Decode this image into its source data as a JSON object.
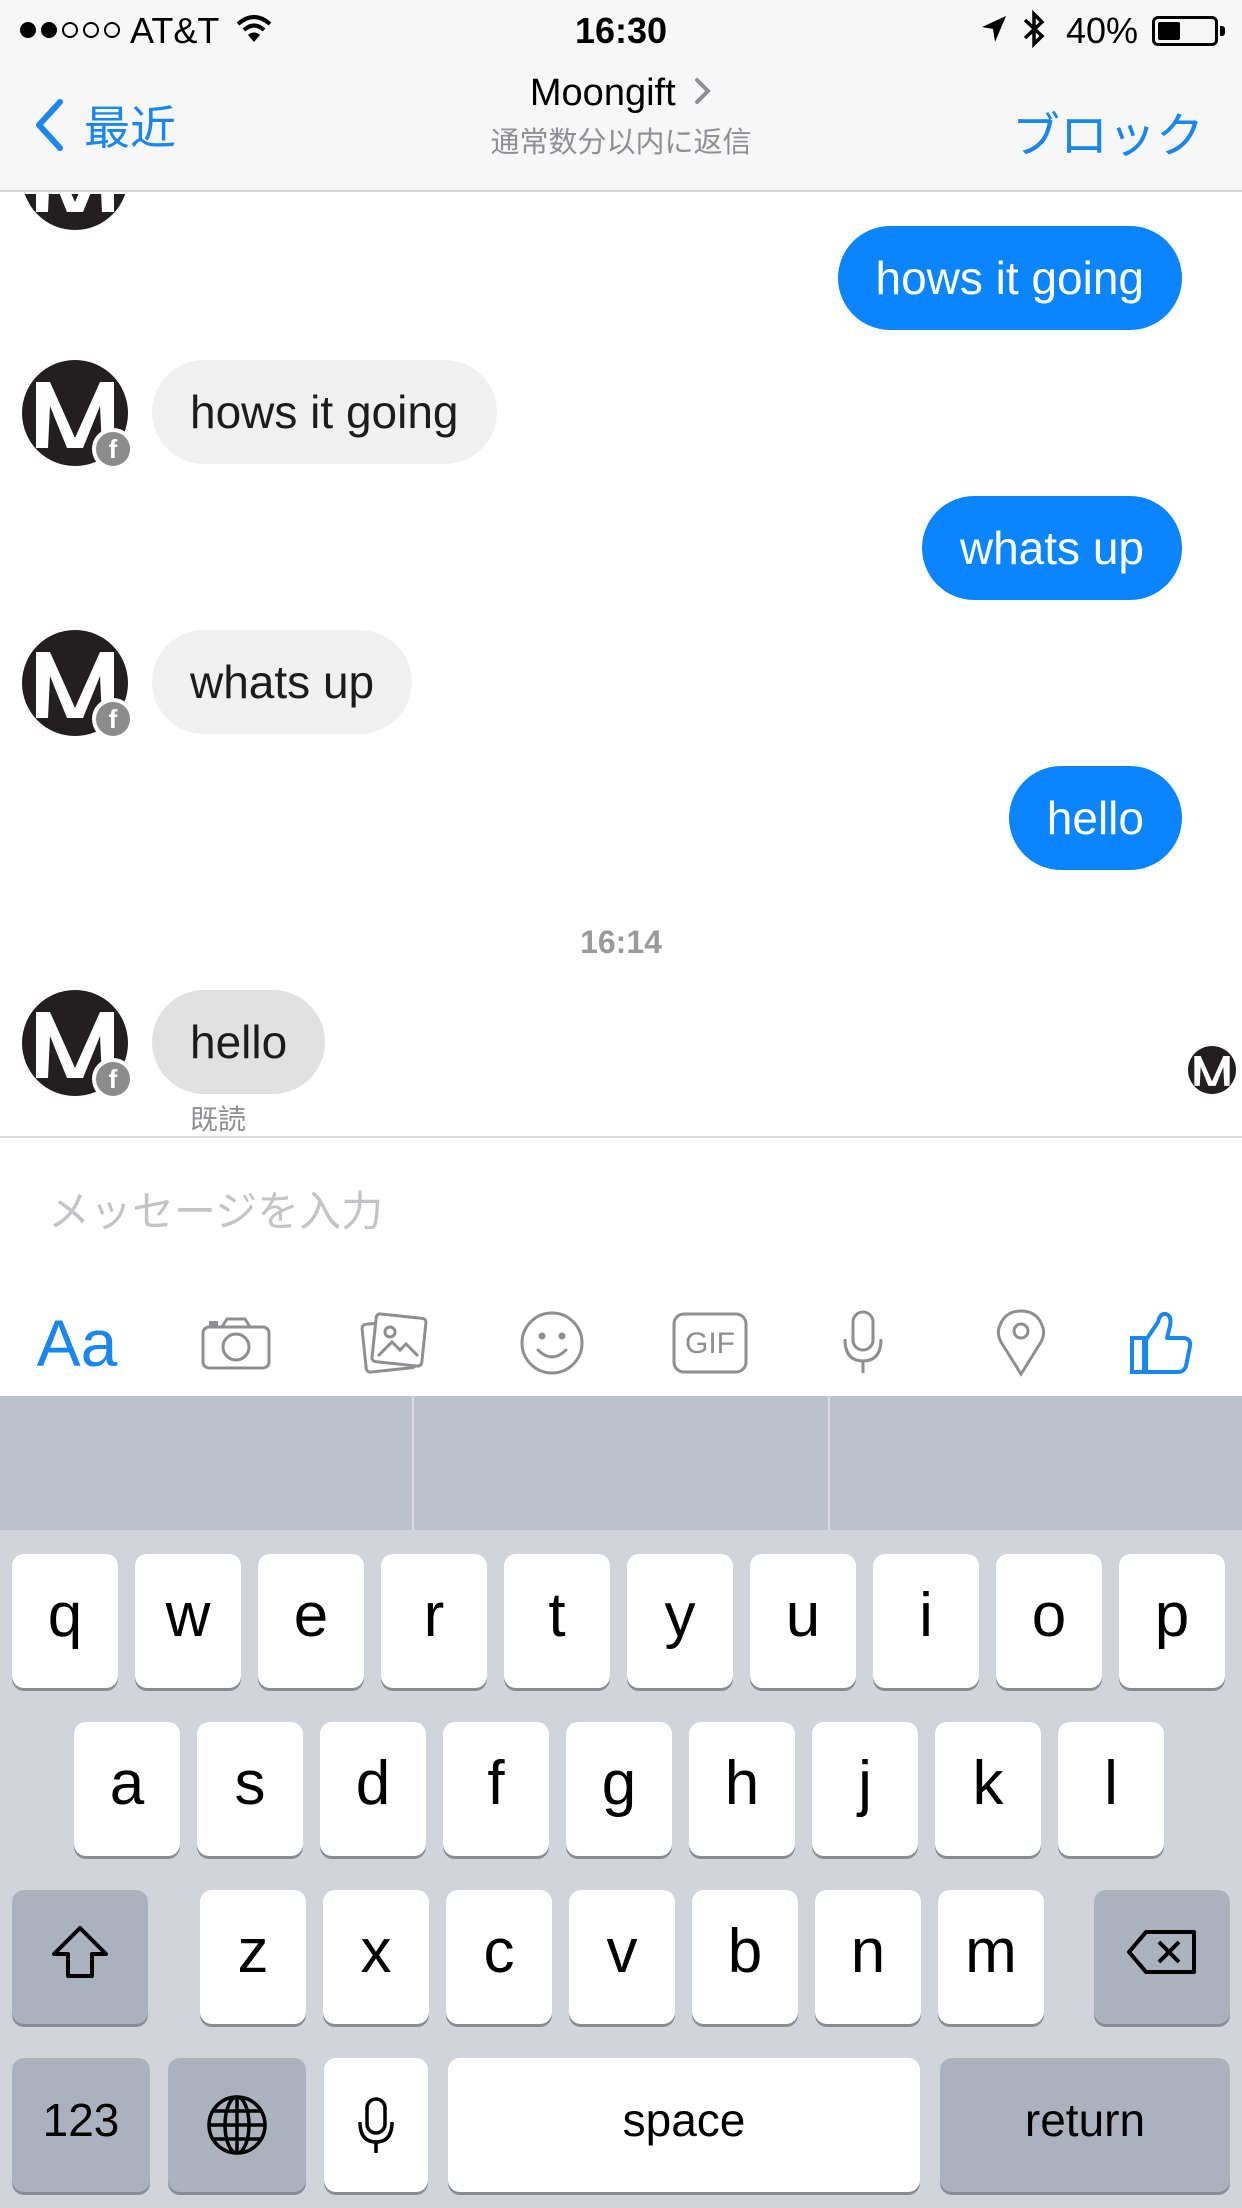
{
  "status_bar": {
    "carrier": "AT&T",
    "time": "16:30",
    "battery": "40%",
    "battery_level": 0.4
  },
  "nav": {
    "back_label": "最近",
    "title": "Moongift",
    "subtitle": "通常数分以内に返信",
    "block_label": "ブロック"
  },
  "messages": [
    {
      "from": "me",
      "text": "hows it going"
    },
    {
      "from": "them",
      "text": "hows it going"
    },
    {
      "from": "me",
      "text": "whats up"
    },
    {
      "from": "them",
      "text": "whats up"
    },
    {
      "from": "me",
      "text": "hello"
    },
    {
      "from": "them",
      "text": "hello"
    }
  ],
  "timestamp": "16:14",
  "read_status": "既読",
  "fb_badge": "f",
  "composer": {
    "placeholder": "メッセージを入力",
    "text_format_label": "Aa",
    "gif_label": "GIF",
    "tools": [
      "text-format-icon",
      "camera-icon",
      "photo-gallery-icon",
      "emoji-icon",
      "gif-icon",
      "microphone-icon",
      "location-pin-icon",
      "thumbs-up-icon"
    ]
  },
  "keyboard": {
    "row1": [
      "q",
      "w",
      "e",
      "r",
      "t",
      "y",
      "u",
      "i",
      "o",
      "p"
    ],
    "row2": [
      "a",
      "s",
      "d",
      "f",
      "g",
      "h",
      "j",
      "k",
      "l"
    ],
    "row3": [
      "z",
      "x",
      "c",
      "v",
      "b",
      "n",
      "m"
    ],
    "numbers_label": "123",
    "space_label": "space",
    "return_label": "return"
  },
  "colors": {
    "accent": "#1a86ef",
    "outgoing_bubble": "#0a84ff",
    "incoming_bubble": "#f0f0f0"
  }
}
